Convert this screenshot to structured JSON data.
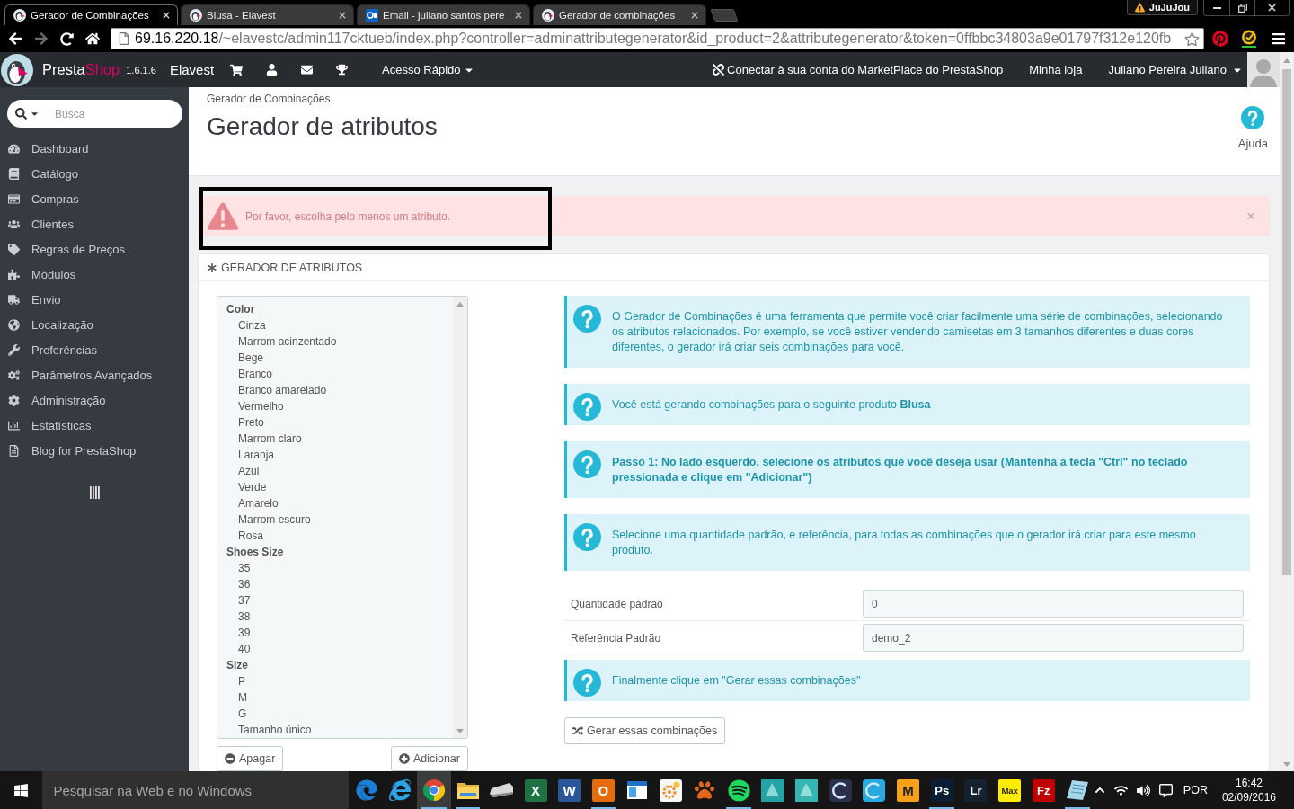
{
  "browser": {
    "tabs": [
      {
        "title": "Gerador de Combinações",
        "selected": true,
        "kind": "shop"
      },
      {
        "title": "Blusa - Elavest",
        "selected": false,
        "kind": "shop"
      },
      {
        "title": "Email - juliano santos pere",
        "selected": false,
        "kind": "mail"
      },
      {
        "title": "Gerador de combinações",
        "selected": false,
        "kind": "shop"
      }
    ],
    "profile": {
      "name": "JuJuJou"
    },
    "forward_disabled": true,
    "address": {
      "host": "69.16.220.18",
      "path": "/~elavestc/admin117cktueb/index.php?controller=adminattributegenerator&id_product=2&attributegenerator&token=0ffbbc34803a9e01797f312e120fb"
    }
  },
  "header": {
    "logo": {
      "primary": "Presta",
      "accent": "Shop"
    },
    "version": "1.6.1.6",
    "shop": "Elavest",
    "quick_access": "Acesso Rápido",
    "marketplace": "Conectar à sua conta do MarketPlace do PrestaShop",
    "my_shop": "Minha loja",
    "employee": "Juliano Pereira Juliano"
  },
  "sidebar": {
    "search_placeholder": "Busca",
    "items": [
      {
        "label": "Dashboard",
        "selected": false
      },
      {
        "label": "Catálogo",
        "selected": false
      },
      {
        "label": "Compras",
        "selected": false
      },
      {
        "label": "Clientes",
        "selected": false
      },
      {
        "label": "Regras de Preços",
        "selected": false
      },
      {
        "label": "Módulos",
        "selected": false
      },
      {
        "label": "Envio",
        "selected": false
      },
      {
        "label": "Localização",
        "selected": false
      },
      {
        "label": "Preferências",
        "selected": false
      },
      {
        "label": "Parâmetros Avançados",
        "selected": false
      },
      {
        "label": "Administração",
        "selected": false
      },
      {
        "label": "Estatísticas",
        "selected": false
      },
      {
        "label": "Blog for PrestaShop",
        "selected": false
      }
    ]
  },
  "page": {
    "breadcrumb": "Gerador de Combinações",
    "title": "Gerador de atributos",
    "help": "Ajuda"
  },
  "alert": {
    "message": "Por favor, escolha pelo menos um atributo.",
    "close": "×",
    "highlighted": true
  },
  "panel": {
    "title": "GERADOR DE ATRIBUTOS",
    "attribute_groups": [
      {
        "label": "Color",
        "options": [
          {
            "label": "Cinza",
            "selected": false
          },
          {
            "label": "Marrom acinzentado",
            "selected": false
          },
          {
            "label": "Bege",
            "selected": false
          },
          {
            "label": "Branco",
            "selected": false
          },
          {
            "label": "Branco amarelado",
            "selected": false
          },
          {
            "label": "Vermelho",
            "selected": false
          },
          {
            "label": "Preto",
            "selected": false
          },
          {
            "label": "Marrom claro",
            "selected": false
          },
          {
            "label": "Laranja",
            "selected": false
          },
          {
            "label": "Azul",
            "selected": false
          },
          {
            "label": "Verde",
            "selected": false
          },
          {
            "label": "Amarelo",
            "selected": false
          },
          {
            "label": "Marrom escuro",
            "selected": false
          },
          {
            "label": "Rosa",
            "selected": false
          }
        ]
      },
      {
        "label": "Shoes Size",
        "options": [
          {
            "label": "35",
            "selected": false
          },
          {
            "label": "36",
            "selected": false
          },
          {
            "label": "37",
            "selected": false
          },
          {
            "label": "38",
            "selected": false
          },
          {
            "label": "39",
            "selected": false
          },
          {
            "label": "40",
            "selected": false
          }
        ]
      },
      {
        "label": "Size",
        "options": [
          {
            "label": "P",
            "selected": false
          },
          {
            "label": "M",
            "selected": false
          },
          {
            "label": "G",
            "selected": false
          },
          {
            "label": "Tamanho único",
            "selected": false
          }
        ]
      }
    ],
    "remove_button": "Apagar",
    "add_button": "Adicionar",
    "info_messages": [
      {
        "text": "O Gerador de Combinações é uma ferramenta que permite você criar facilmente uma série de combinações, selecionando os atributos relacionados. Por exemplo, se você estiver vendendo camisetas em 3 tamanhos diferentes e duas cores diferentes, o gerador irá criar seis combinações para você.",
        "strong": false
      },
      {
        "text": "Você está gerando combinações para o seguinte produto **Blusa**",
        "strong": false
      },
      {
        "text": "Passo 1: No lado esquerdo, selecione os atributos que você deseja usar (Mantenha a tecla \"Ctrl\" no teclado pressionada e clique em \"Adicionar\")",
        "strong": true
      },
      {
        "text": "Selecione uma quantidade padrão, e referência, para todas as combinações que o gerador irá criar para este mesmo produto.",
        "strong": false
      }
    ],
    "fields": [
      {
        "label": "Quantidade padrão",
        "value": "0"
      },
      {
        "label": "Referência Padrão",
        "value": "demo_2"
      }
    ],
    "final_message": {
      "text": "Finalmente clique em \"Gerar essas combinações\"",
      "strong": false
    },
    "generate_button": "Gerar essas combinações"
  },
  "taskbar": {
    "search_placeholder": "Pesquisar na Web e no Windows",
    "apps": [
      {
        "kind": "edge",
        "selected": false,
        "running": false
      },
      {
        "kind": "ie",
        "selected": false,
        "running": false
      },
      {
        "kind": "chrome",
        "selected": true,
        "running": true
      },
      {
        "kind": "folder",
        "selected": false,
        "running": true
      },
      {
        "kind": "scanner",
        "selected": false,
        "running": false
      },
      {
        "kind": "letter",
        "glyph": "X",
        "color": "#1f7244",
        "selected": false,
        "running": false
      },
      {
        "kind": "letter",
        "glyph": "W",
        "color": "#2b579a",
        "selected": false,
        "running": false
      },
      {
        "kind": "letter",
        "glyph": "O",
        "color": "#e46c0a",
        "selected": false,
        "running": true
      },
      {
        "kind": "window",
        "selected": false,
        "running": false
      },
      {
        "kind": "gear",
        "selected": false,
        "running": false
      },
      {
        "kind": "paw",
        "selected": false,
        "running": false
      },
      {
        "kind": "spotify",
        "selected": false,
        "running": true
      },
      {
        "kind": "tile",
        "color": "#24a3a6",
        "selected": false,
        "running": false
      },
      {
        "kind": "tile",
        "color": "#35b6b3",
        "selected": false,
        "running": false
      },
      {
        "kind": "ring",
        "color": "#2b2f4a",
        "selected": false,
        "running": false
      },
      {
        "kind": "ring",
        "color": "#29a9df",
        "selected": false,
        "running": false
      },
      {
        "kind": "letter",
        "glyph": "M",
        "color": "#f7a11a",
        "selected": false,
        "running": false
      },
      {
        "kind": "letter",
        "glyph": "Ps",
        "color": "#0b1e34",
        "selected": false,
        "running": true
      },
      {
        "kind": "letter",
        "glyph": "Lr",
        "color": "#13222e",
        "selected": false,
        "running": false
      },
      {
        "kind": "letter",
        "glyph": "Max",
        "color": "#ffec00",
        "selected": false,
        "running": false
      },
      {
        "kind": "letter",
        "glyph": "Fz",
        "color": "#bf0000",
        "selected": false,
        "running": false
      },
      {
        "kind": "notepad",
        "selected": false,
        "running": true
      }
    ],
    "language": "POR",
    "time": "16:42",
    "date": "02/09/2016"
  }
}
